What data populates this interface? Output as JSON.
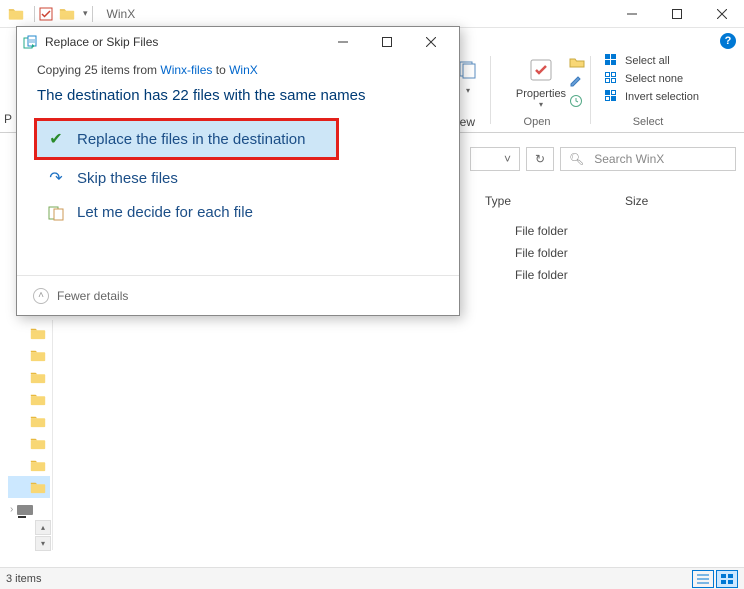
{
  "explorer": {
    "title": "WinX",
    "address_dropdown_arrow": "˅",
    "refresh_icon": "↻",
    "search_placeholder": "Search WinX",
    "partial_p_letter": "P",
    "partial_view_tab": "iew",
    "columns": {
      "type": "Type",
      "size": "Size"
    },
    "rows": [
      "File folder",
      "File folder",
      "File folder"
    ],
    "status": "3 items",
    "ribbon": {
      "properties": "Properties",
      "open_group": "Open",
      "select_all": "Select all",
      "select_none": "Select none",
      "invert_selection": "Invert selection",
      "select_group": "Select"
    }
  },
  "dialog": {
    "title": "Replace or Skip Files",
    "copying_prefix": "Copying 25 items from ",
    "copying_src": "Winx-files",
    "copying_mid": " to ",
    "copying_dst": "WinX",
    "heading": "The destination has 22 files with the same names",
    "opt_replace": "Replace the files in the destination",
    "opt_skip": "Skip these files",
    "opt_decide": "Let me decide for each file",
    "fewer_details": "Fewer details"
  }
}
